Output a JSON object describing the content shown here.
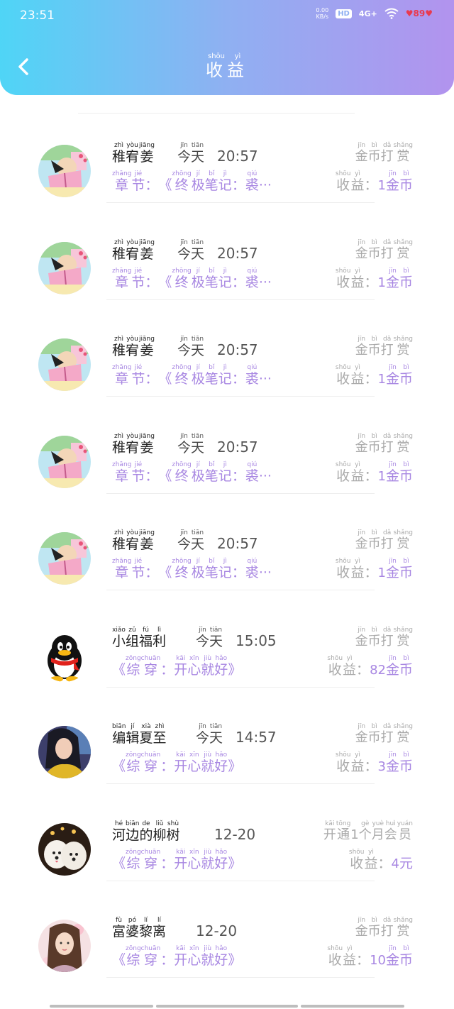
{
  "status_bar": {
    "time": "23:51",
    "net_speed": "0.00",
    "net_unit": "KB/s",
    "hd": "HD",
    "signal": "4G+",
    "battery": "89"
  },
  "header": {
    "title_chars": [
      {
        "c": "收",
        "p": "shōu"
      },
      {
        "c": "益",
        "p": "yì"
      }
    ]
  },
  "entries": [
    {
      "avatar": "anime-reading",
      "name": [
        {
          "c": "稚",
          "p": "zhì"
        },
        {
          "c": "宥",
          "p": "yòu"
        },
        {
          "c": "姜",
          "p": "jiāng"
        }
      ],
      "day": [
        {
          "c": "今",
          "p": "jīn"
        },
        {
          "c": "天",
          "p": "tiān"
        }
      ],
      "time": "20:57",
      "tip": [
        {
          "c": "金",
          "p": "jīn"
        },
        {
          "c": "币",
          "p": "bì"
        },
        {
          "c": "打",
          "p": "dǎ"
        },
        {
          "c": "赏",
          "p": "shǎng"
        }
      ],
      "sub": [
        {
          "c": "章",
          "p": "zhāng"
        },
        {
          "c": "节",
          "p": "jié"
        },
        {
          "c": "：",
          "p": ""
        },
        {
          "c": "《",
          "p": ""
        },
        {
          "c": "终",
          "p": "zhōng"
        },
        {
          "c": "极",
          "p": "jí"
        },
        {
          "c": "笔",
          "p": "bǐ"
        },
        {
          "c": "记",
          "p": "jì"
        },
        {
          "c": "：",
          "p": ""
        },
        {
          "c": "裘",
          "p": "qiú"
        },
        {
          "c": "···",
          "p": ""
        }
      ],
      "earn_label": [
        {
          "c": "收",
          "p": "shōu"
        },
        {
          "c": "益",
          "p": "yì"
        },
        {
          "c": "：",
          "p": ""
        }
      ],
      "amount": "1",
      "unit": [
        {
          "c": "金",
          "p": "jīn"
        },
        {
          "c": "币",
          "p": "bì"
        }
      ]
    },
    {
      "avatar": "anime-reading",
      "name": [
        {
          "c": "稚",
          "p": "zhì"
        },
        {
          "c": "宥",
          "p": "yòu"
        },
        {
          "c": "姜",
          "p": "jiāng"
        }
      ],
      "day": [
        {
          "c": "今",
          "p": "jīn"
        },
        {
          "c": "天",
          "p": "tiān"
        }
      ],
      "time": "20:57",
      "tip": [
        {
          "c": "金",
          "p": "jīn"
        },
        {
          "c": "币",
          "p": "bì"
        },
        {
          "c": "打",
          "p": "dǎ"
        },
        {
          "c": "赏",
          "p": "shǎng"
        }
      ],
      "sub": [
        {
          "c": "章",
          "p": "zhāng"
        },
        {
          "c": "节",
          "p": "jié"
        },
        {
          "c": "：",
          "p": ""
        },
        {
          "c": "《",
          "p": ""
        },
        {
          "c": "终",
          "p": "zhōng"
        },
        {
          "c": "极",
          "p": "jí"
        },
        {
          "c": "笔",
          "p": "bǐ"
        },
        {
          "c": "记",
          "p": "jì"
        },
        {
          "c": "：",
          "p": ""
        },
        {
          "c": "裘",
          "p": "qiú"
        },
        {
          "c": "···",
          "p": ""
        }
      ],
      "earn_label": [
        {
          "c": "收",
          "p": "shōu"
        },
        {
          "c": "益",
          "p": "yì"
        },
        {
          "c": "：",
          "p": ""
        }
      ],
      "amount": "1",
      "unit": [
        {
          "c": "金",
          "p": "jīn"
        },
        {
          "c": "币",
          "p": "bì"
        }
      ]
    },
    {
      "avatar": "anime-reading",
      "name": [
        {
          "c": "稚",
          "p": "zhì"
        },
        {
          "c": "宥",
          "p": "yòu"
        },
        {
          "c": "姜",
          "p": "jiāng"
        }
      ],
      "day": [
        {
          "c": "今",
          "p": "jīn"
        },
        {
          "c": "天",
          "p": "tiān"
        }
      ],
      "time": "20:57",
      "tip": [
        {
          "c": "金",
          "p": "jīn"
        },
        {
          "c": "币",
          "p": "bì"
        },
        {
          "c": "打",
          "p": "dǎ"
        },
        {
          "c": "赏",
          "p": "shǎng"
        }
      ],
      "sub": [
        {
          "c": "章",
          "p": "zhāng"
        },
        {
          "c": "节",
          "p": "jié"
        },
        {
          "c": "：",
          "p": ""
        },
        {
          "c": "《",
          "p": ""
        },
        {
          "c": "终",
          "p": "zhōng"
        },
        {
          "c": "极",
          "p": "jí"
        },
        {
          "c": "笔",
          "p": "bǐ"
        },
        {
          "c": "记",
          "p": "jì"
        },
        {
          "c": "：",
          "p": ""
        },
        {
          "c": "裘",
          "p": "qiú"
        },
        {
          "c": "···",
          "p": ""
        }
      ],
      "earn_label": [
        {
          "c": "收",
          "p": "shōu"
        },
        {
          "c": "益",
          "p": "yì"
        },
        {
          "c": "：",
          "p": ""
        }
      ],
      "amount": "1",
      "unit": [
        {
          "c": "金",
          "p": "jīn"
        },
        {
          "c": "币",
          "p": "bì"
        }
      ]
    },
    {
      "avatar": "anime-reading",
      "name": [
        {
          "c": "稚",
          "p": "zhì"
        },
        {
          "c": "宥",
          "p": "yòu"
        },
        {
          "c": "姜",
          "p": "jiāng"
        }
      ],
      "day": [
        {
          "c": "今",
          "p": "jīn"
        },
        {
          "c": "天",
          "p": "tiān"
        }
      ],
      "time": "20:57",
      "tip": [
        {
          "c": "金",
          "p": "jīn"
        },
        {
          "c": "币",
          "p": "bì"
        },
        {
          "c": "打",
          "p": "dǎ"
        },
        {
          "c": "赏",
          "p": "shǎng"
        }
      ],
      "sub": [
        {
          "c": "章",
          "p": "zhāng"
        },
        {
          "c": "节",
          "p": "jié"
        },
        {
          "c": "：",
          "p": ""
        },
        {
          "c": "《",
          "p": ""
        },
        {
          "c": "终",
          "p": "zhōng"
        },
        {
          "c": "极",
          "p": "jí"
        },
        {
          "c": "笔",
          "p": "bǐ"
        },
        {
          "c": "记",
          "p": "jì"
        },
        {
          "c": "：",
          "p": ""
        },
        {
          "c": "裘",
          "p": "qiú"
        },
        {
          "c": "···",
          "p": ""
        }
      ],
      "earn_label": [
        {
          "c": "收",
          "p": "shōu"
        },
        {
          "c": "益",
          "p": "yì"
        },
        {
          "c": "：",
          "p": ""
        }
      ],
      "amount": "1",
      "unit": [
        {
          "c": "金",
          "p": "jīn"
        },
        {
          "c": "币",
          "p": "bì"
        }
      ]
    },
    {
      "avatar": "anime-reading",
      "name": [
        {
          "c": "稚",
          "p": "zhì"
        },
        {
          "c": "宥",
          "p": "yòu"
        },
        {
          "c": "姜",
          "p": "jiāng"
        }
      ],
      "day": [
        {
          "c": "今",
          "p": "jīn"
        },
        {
          "c": "天",
          "p": "tiān"
        }
      ],
      "time": "20:57",
      "tip": [
        {
          "c": "金",
          "p": "jīn"
        },
        {
          "c": "币",
          "p": "bì"
        },
        {
          "c": "打",
          "p": "dǎ"
        },
        {
          "c": "赏",
          "p": "shǎng"
        }
      ],
      "sub": [
        {
          "c": "章",
          "p": "zhāng"
        },
        {
          "c": "节",
          "p": "jié"
        },
        {
          "c": "：",
          "p": ""
        },
        {
          "c": "《",
          "p": ""
        },
        {
          "c": "终",
          "p": "zhōng"
        },
        {
          "c": "极",
          "p": "jí"
        },
        {
          "c": "笔",
          "p": "bǐ"
        },
        {
          "c": "记",
          "p": "jì"
        },
        {
          "c": "：",
          "p": ""
        },
        {
          "c": "裘",
          "p": "qiú"
        },
        {
          "c": "···",
          "p": ""
        }
      ],
      "earn_label": [
        {
          "c": "收",
          "p": "shōu"
        },
        {
          "c": "益",
          "p": "yì"
        },
        {
          "c": "：",
          "p": ""
        }
      ],
      "amount": "1",
      "unit": [
        {
          "c": "金",
          "p": "jīn"
        },
        {
          "c": "币",
          "p": "bì"
        }
      ]
    },
    {
      "avatar": "penguin",
      "name": [
        {
          "c": "小",
          "p": "xiǎo"
        },
        {
          "c": "组",
          "p": "zǔ"
        },
        {
          "c": "福",
          "p": "fú"
        },
        {
          "c": "利",
          "p": "lì"
        }
      ],
      "day": [
        {
          "c": "今",
          "p": "jīn"
        },
        {
          "c": "天",
          "p": "tiān"
        }
      ],
      "time": "15:05",
      "tip": [
        {
          "c": "金",
          "p": "jīn"
        },
        {
          "c": "币",
          "p": "bì"
        },
        {
          "c": "打",
          "p": "dǎ"
        },
        {
          "c": "赏",
          "p": "shǎng"
        }
      ],
      "sub": [
        {
          "c": "《",
          "p": ""
        },
        {
          "c": "综",
          "p": "zōng"
        },
        {
          "c": "穿",
          "p": "chuān"
        },
        {
          "c": "：",
          "p": ""
        },
        {
          "c": "开",
          "p": "kāi"
        },
        {
          "c": "心",
          "p": "xīn"
        },
        {
          "c": "就",
          "p": "jiù"
        },
        {
          "c": "好",
          "p": "hǎo"
        },
        {
          "c": "》",
          "p": ""
        }
      ],
      "earn_label": [
        {
          "c": "收",
          "p": "shōu"
        },
        {
          "c": "益",
          "p": "yì"
        },
        {
          "c": "：",
          "p": ""
        }
      ],
      "amount": "82",
      "unit": [
        {
          "c": "金",
          "p": "jīn"
        },
        {
          "c": "币",
          "p": "bì"
        }
      ]
    },
    {
      "avatar": "woman-dark-hair",
      "name": [
        {
          "c": "编",
          "p": "biān"
        },
        {
          "c": "辑",
          "p": "jí"
        },
        {
          "c": "夏",
          "p": "xià"
        },
        {
          "c": "至",
          "p": "zhì"
        }
      ],
      "day": [
        {
          "c": "今",
          "p": "jīn"
        },
        {
          "c": "天",
          "p": "tiān"
        }
      ],
      "time": "14:57",
      "tip": [
        {
          "c": "金",
          "p": "jīn"
        },
        {
          "c": "币",
          "p": "bì"
        },
        {
          "c": "打",
          "p": "dǎ"
        },
        {
          "c": "赏",
          "p": "shǎng"
        }
      ],
      "sub": [
        {
          "c": "《",
          "p": ""
        },
        {
          "c": "综",
          "p": "zōng"
        },
        {
          "c": "穿",
          "p": "chuān"
        },
        {
          "c": "：",
          "p": ""
        },
        {
          "c": "开",
          "p": "kāi"
        },
        {
          "c": "心",
          "p": "xīn"
        },
        {
          "c": "就",
          "p": "jiù"
        },
        {
          "c": "好",
          "p": "hǎo"
        },
        {
          "c": "》",
          "p": ""
        }
      ],
      "earn_label": [
        {
          "c": "收",
          "p": "shōu"
        },
        {
          "c": "益",
          "p": "yì"
        },
        {
          "c": "：",
          "p": ""
        }
      ],
      "amount": "3",
      "unit": [
        {
          "c": "金",
          "p": "jīn"
        },
        {
          "c": "币",
          "p": "bì"
        }
      ]
    },
    {
      "avatar": "white-dogs",
      "name": [
        {
          "c": "河",
          "p": "hé"
        },
        {
          "c": "边",
          "p": "biān"
        },
        {
          "c": "的",
          "p": "de"
        },
        {
          "c": "柳",
          "p": "liǔ"
        },
        {
          "c": "树",
          "p": "shù"
        }
      ],
      "day": [],
      "time": "12-20",
      "tip": [
        {
          "c": "开",
          "p": "kāi"
        },
        {
          "c": "通",
          "p": "tōng"
        },
        {
          "c": "1",
          "p": ""
        },
        {
          "c": "个",
          "p": "gè"
        },
        {
          "c": "月",
          "p": "yuè"
        },
        {
          "c": "会",
          "p": "huì"
        },
        {
          "c": "员",
          "p": "yuán"
        }
      ],
      "sub": [
        {
          "c": "《",
          "p": ""
        },
        {
          "c": "综",
          "p": "zōng"
        },
        {
          "c": "穿",
          "p": "chuān"
        },
        {
          "c": "：",
          "p": ""
        },
        {
          "c": "开",
          "p": "kāi"
        },
        {
          "c": "心",
          "p": "xīn"
        },
        {
          "c": "就",
          "p": "jiù"
        },
        {
          "c": "好",
          "p": "hǎo"
        },
        {
          "c": "》",
          "p": ""
        }
      ],
      "earn_label": [
        {
          "c": "收",
          "p": "shōu"
        },
        {
          "c": "益",
          "p": "yì"
        },
        {
          "c": "：",
          "p": ""
        }
      ],
      "amount": "4",
      "unit": [
        {
          "c": "元",
          "p": ""
        }
      ]
    },
    {
      "avatar": "illustrated-woman",
      "name": [
        {
          "c": "富",
          "p": "fù"
        },
        {
          "c": "婆",
          "p": "pó"
        },
        {
          "c": "黎",
          "p": "lí"
        },
        {
          "c": "离",
          "p": "lí"
        }
      ],
      "day": [],
      "time": "12-20",
      "tip": [
        {
          "c": "金",
          "p": "jīn"
        },
        {
          "c": "币",
          "p": "bì"
        },
        {
          "c": "打",
          "p": "dǎ"
        },
        {
          "c": "赏",
          "p": "shǎng"
        }
      ],
      "sub": [
        {
          "c": "《",
          "p": ""
        },
        {
          "c": "综",
          "p": "zōng"
        },
        {
          "c": "穿",
          "p": "chuān"
        },
        {
          "c": "：",
          "p": ""
        },
        {
          "c": "开",
          "p": "kāi"
        },
        {
          "c": "心",
          "p": "xīn"
        },
        {
          "c": "就",
          "p": "jiù"
        },
        {
          "c": "好",
          "p": "hǎo"
        },
        {
          "c": "》",
          "p": ""
        }
      ],
      "earn_label": [
        {
          "c": "收",
          "p": "shōu"
        },
        {
          "c": "益",
          "p": "yì"
        },
        {
          "c": "：",
          "p": ""
        }
      ],
      "amount": "10",
      "unit": [
        {
          "c": "金",
          "p": "jīn"
        },
        {
          "c": "币",
          "p": "bì"
        }
      ]
    }
  ],
  "colors": {
    "header_start": "#4fd5f6",
    "header_end": "#b293ee",
    "accent_purple": "#a887e2",
    "muted_gray": "#aaaaaa"
  }
}
